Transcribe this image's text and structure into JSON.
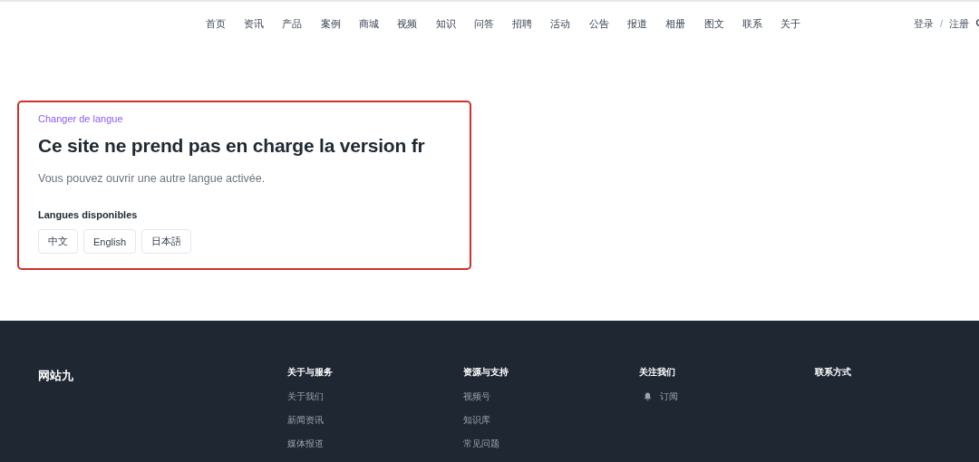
{
  "nav": {
    "items": [
      "首页",
      "资讯",
      "产品",
      "案例",
      "商城",
      "视频",
      "知识",
      "问答",
      "招聘",
      "活动",
      "公告",
      "报道",
      "相册",
      "图文",
      "联系",
      "关于"
    ],
    "auth": [
      "登录",
      "注册"
    ],
    "separator": "/"
  },
  "notice": {
    "eyebrow": "Changer de langue",
    "title": "Ce site ne prend pas en charge la version fr",
    "message": "Vous pouvez ouvrir une autre langue activée.",
    "languages_label": "Langues disponibles",
    "languages": [
      "中文",
      "English",
      "日本語"
    ]
  },
  "footer": {
    "brand": "网站九",
    "columns": [
      {
        "title": "关于与服务",
        "links": [
          {
            "label": "关于我们"
          },
          {
            "label": "新闻资讯"
          },
          {
            "label": "媒体报道"
          }
        ]
      },
      {
        "title": "资源与支持",
        "links": [
          {
            "label": "视频号"
          },
          {
            "label": "知识库"
          },
          {
            "label": "常见问题"
          }
        ]
      },
      {
        "title": "关注我们",
        "links": [
          {
            "label": "订阅",
            "kind": "bell"
          }
        ]
      },
      {
        "title": "联系方式"
      }
    ]
  }
}
